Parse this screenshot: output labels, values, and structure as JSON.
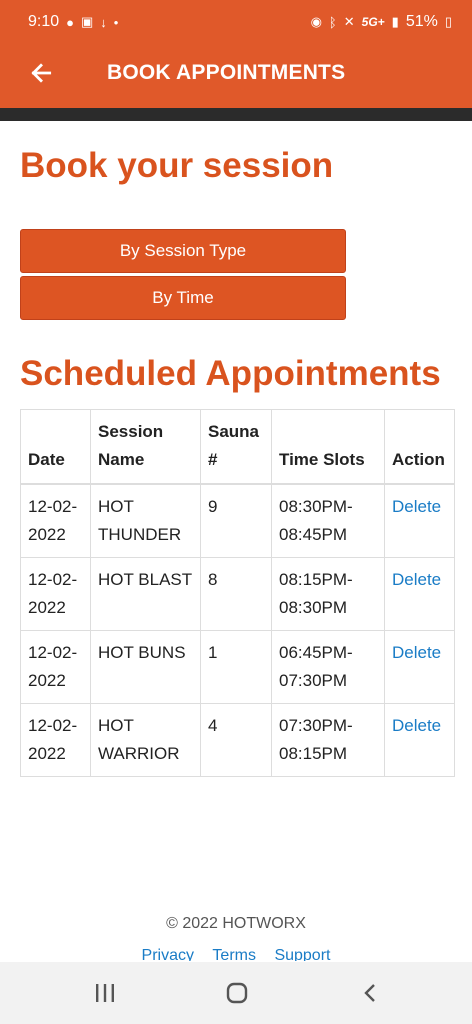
{
  "status": {
    "time": "9:10",
    "battery": "51%",
    "network": "5G+"
  },
  "appbar": {
    "title": "BOOK APPOINTMENTS"
  },
  "page": {
    "title": "Book your session",
    "by_session_type": "By Session Type",
    "by_time": "By Time",
    "scheduled_title": "Scheduled Appointments"
  },
  "table": {
    "headers": {
      "date": "Date",
      "session_name": "Session Name",
      "sauna": "Sauna #",
      "time_slots": "Time Slots",
      "action": "Action"
    },
    "rows": [
      {
        "date": "12-02-2022",
        "session": "HOT THUNDER",
        "sauna": "9",
        "time": "08:30PM-08:45PM",
        "action": "Delete"
      },
      {
        "date": "12-02-2022",
        "session": "HOT BLAST",
        "sauna": "8",
        "time": "08:15PM-08:30PM",
        "action": "Delete"
      },
      {
        "date": "12-02-2022",
        "session": "HOT BUNS",
        "sauna": "1",
        "time": "06:45PM-07:30PM",
        "action": "Delete"
      },
      {
        "date": "12-02-2022",
        "session": "HOT WARRIOR",
        "sauna": "4",
        "time": "07:30PM-08:15PM",
        "action": "Delete"
      }
    ]
  },
  "footer": {
    "copyright": "© 2022 HOTWORX",
    "privacy": "Privacy",
    "terms": "Terms",
    "support": "Support"
  },
  "colors": {
    "brand": "#e0592a",
    "heading": "#d9531e",
    "link": "#1a7cc6"
  }
}
